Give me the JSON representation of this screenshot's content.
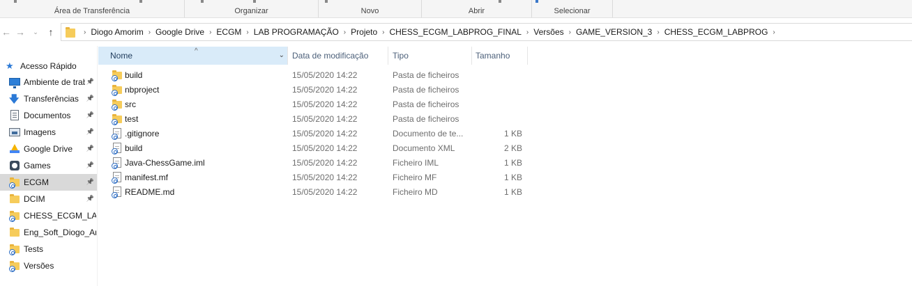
{
  "ribbon": {
    "groups": [
      "Área de Transferência",
      "Organizar",
      "Novo",
      "Abrir",
      "Selecionar"
    ]
  },
  "nav": {
    "back_icon": "arrow-left-icon",
    "forward_icon": "arrow-right-icon",
    "history_icon": "chevron-down-icon",
    "up_icon": "arrow-up-icon"
  },
  "breadcrumb": [
    "Diogo Amorim",
    "Google Drive",
    "ECGM",
    "LAB PROGRAMAÇÃO",
    "Projeto",
    "CHESS_ECGM_LABPROG_FINAL",
    "Versões",
    "GAME_VERSION_3",
    "CHESS_ECGM_LABPROG"
  ],
  "sidebar": {
    "items": [
      {
        "label": "Acesso Rápido",
        "icon": "star-icon",
        "pinned": false
      },
      {
        "label": "Ambiente de trab",
        "icon": "desktop-icon",
        "pinned": true
      },
      {
        "label": "Transferências",
        "icon": "download-icon",
        "pinned": true
      },
      {
        "label": "Documentos",
        "icon": "documents-icon",
        "pinned": true
      },
      {
        "label": "Imagens",
        "icon": "pictures-icon",
        "pinned": true
      },
      {
        "label": "Google Drive",
        "icon": "google-drive-icon",
        "pinned": true
      },
      {
        "label": "Games",
        "icon": "games-icon",
        "pinned": true
      },
      {
        "label": "ECGM",
        "icon": "synced-folder-icon",
        "pinned": true,
        "selected": true
      },
      {
        "label": "DCIM",
        "icon": "folder-icon",
        "pinned": true
      },
      {
        "label": "CHESS_ECGM_LABPROG",
        "icon": "synced-folder-icon",
        "pinned": false
      },
      {
        "label": "Eng_Soft_Diogo_Am",
        "icon": "folder-icon",
        "pinned": false
      },
      {
        "label": "Tests",
        "icon": "synced-folder-icon",
        "pinned": false
      },
      {
        "label": "Versões",
        "icon": "synced-folder-icon",
        "pinned": false
      }
    ]
  },
  "columns": {
    "name": "Nome",
    "date": "Data de modificação",
    "type": "Tipo",
    "size": "Tamanho"
  },
  "files": [
    {
      "name": "build",
      "date": "15/05/2020 14:22",
      "type": "Pasta de ficheiros",
      "size": "",
      "icon": "synced-folder-icon"
    },
    {
      "name": "nbproject",
      "date": "15/05/2020 14:22",
      "type": "Pasta de ficheiros",
      "size": "",
      "icon": "synced-folder-icon"
    },
    {
      "name": "src",
      "date": "15/05/2020 14:22",
      "type": "Pasta de ficheiros",
      "size": "",
      "icon": "synced-folder-icon"
    },
    {
      "name": "test",
      "date": "15/05/2020 14:22",
      "type": "Pasta de ficheiros",
      "size": "",
      "icon": "synced-folder-icon"
    },
    {
      "name": ".gitignore",
      "date": "15/05/2020 14:22",
      "type": "Documento de te...",
      "size": "1 KB",
      "icon": "synced-file-icon"
    },
    {
      "name": "build",
      "date": "15/05/2020 14:22",
      "type": "Documento XML",
      "size": "2 KB",
      "icon": "synced-file-icon"
    },
    {
      "name": "Java-ChessGame.iml",
      "date": "15/05/2020 14:22",
      "type": "Ficheiro IML",
      "size": "1 KB",
      "icon": "synced-file-icon"
    },
    {
      "name": "manifest.mf",
      "date": "15/05/2020 14:22",
      "type": "Ficheiro MF",
      "size": "1 KB",
      "icon": "synced-file-icon"
    },
    {
      "name": "README.md",
      "date": "15/05/2020 14:22",
      "type": "Ficheiro MD",
      "size": "1 KB",
      "icon": "synced-file-icon"
    }
  ]
}
